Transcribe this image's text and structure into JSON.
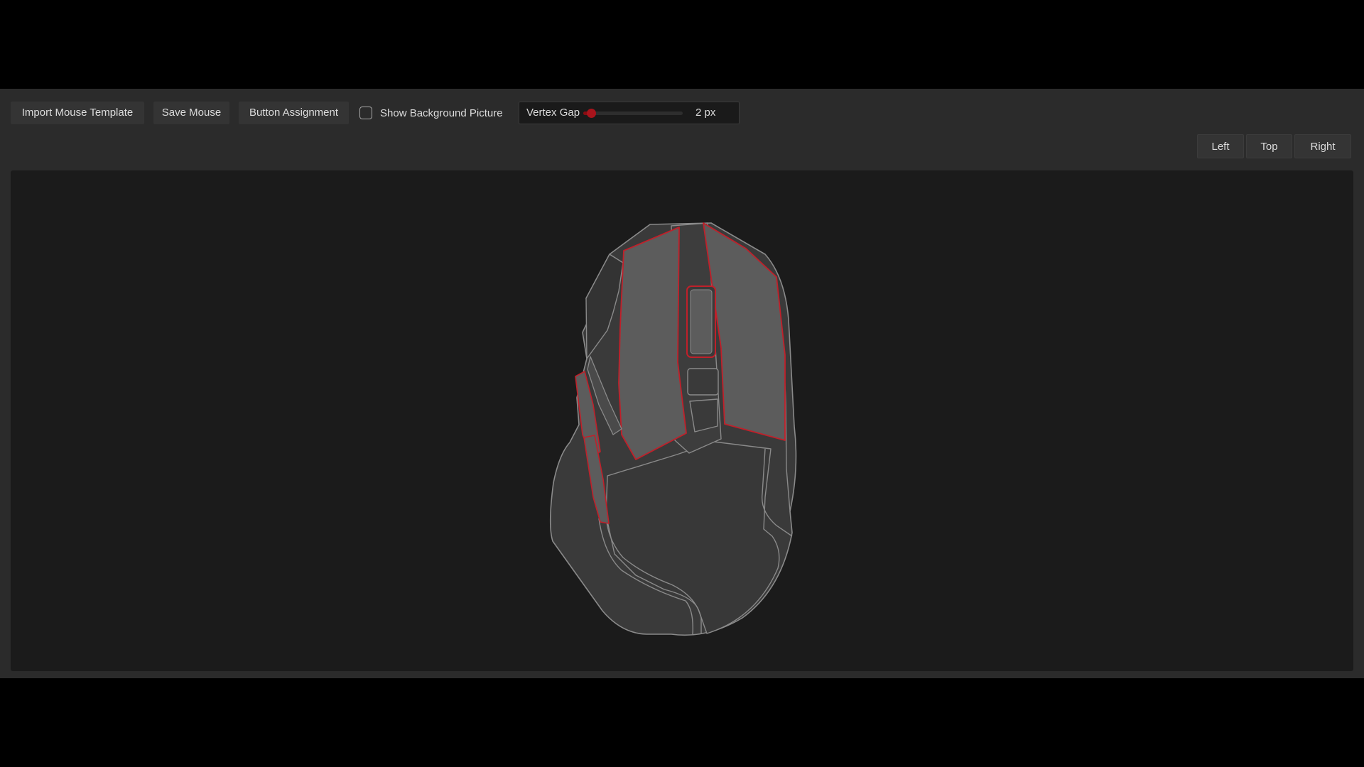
{
  "toolbar": {
    "import_label": "Import Mouse Template",
    "save_label": "Save Mouse",
    "assign_label": "Button Assignment",
    "show_bg_label": "Show Background Picture",
    "show_bg_checked": false
  },
  "vertex_gap": {
    "label": "Vertex Gap",
    "value_text": "2 px",
    "value": 2,
    "fill_fraction": 0.08
  },
  "views": {
    "left": "Left",
    "top": "Top",
    "right": "Right"
  },
  "colors": {
    "accent": "#c0202a",
    "mouse_fill": "#3a3a3a",
    "mouse_outline": "#8a8a8a",
    "segment_fill": "#5c5c5c",
    "canvas_bg": "#1b1b1b"
  }
}
